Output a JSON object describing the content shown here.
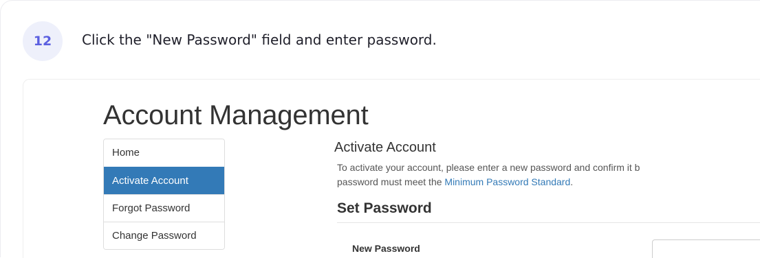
{
  "step": {
    "number": "12",
    "instruction": "Click the \"New Password\" field and enter password."
  },
  "app": {
    "title": "Account Management"
  },
  "sidebar": {
    "items": [
      {
        "label": "Home",
        "active": false
      },
      {
        "label": "Activate Account",
        "active": true
      },
      {
        "label": "Forgot Password",
        "active": false
      },
      {
        "label": "Change Password",
        "active": false
      }
    ]
  },
  "main": {
    "heading": "Activate Account",
    "intro_line1": "To activate your account, please enter a new password and confirm it b",
    "intro_line2_prefix": "password must meet the ",
    "intro_link": "Minimum Password Standard",
    "intro_line2_suffix": ".",
    "set_password_heading": "Set Password",
    "new_password_label": "New Password"
  },
  "colors": {
    "accent": "#337ab7",
    "badge_bg": "#eef0fb",
    "badge_text": "#5b5fe0"
  }
}
